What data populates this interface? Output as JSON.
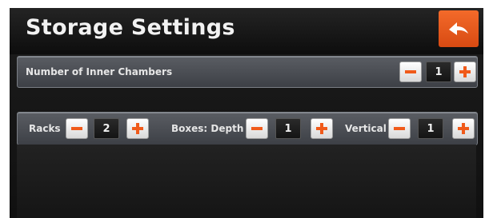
{
  "header": {
    "title": "Storage Settings"
  },
  "icons": {
    "back": "back-arrow-icon",
    "minus": "minus-icon",
    "plus": "plus-icon"
  },
  "colors": {
    "accent": "#f05a1a",
    "header_button": "#e8561b"
  },
  "chambers": {
    "label": "Number of Inner Chambers",
    "value": "1"
  },
  "racks": {
    "label": "Racks",
    "value": "2"
  },
  "boxes_depth": {
    "label": "Boxes: Depth",
    "value": "1"
  },
  "vertical": {
    "label": "Vertical",
    "value": "1"
  }
}
